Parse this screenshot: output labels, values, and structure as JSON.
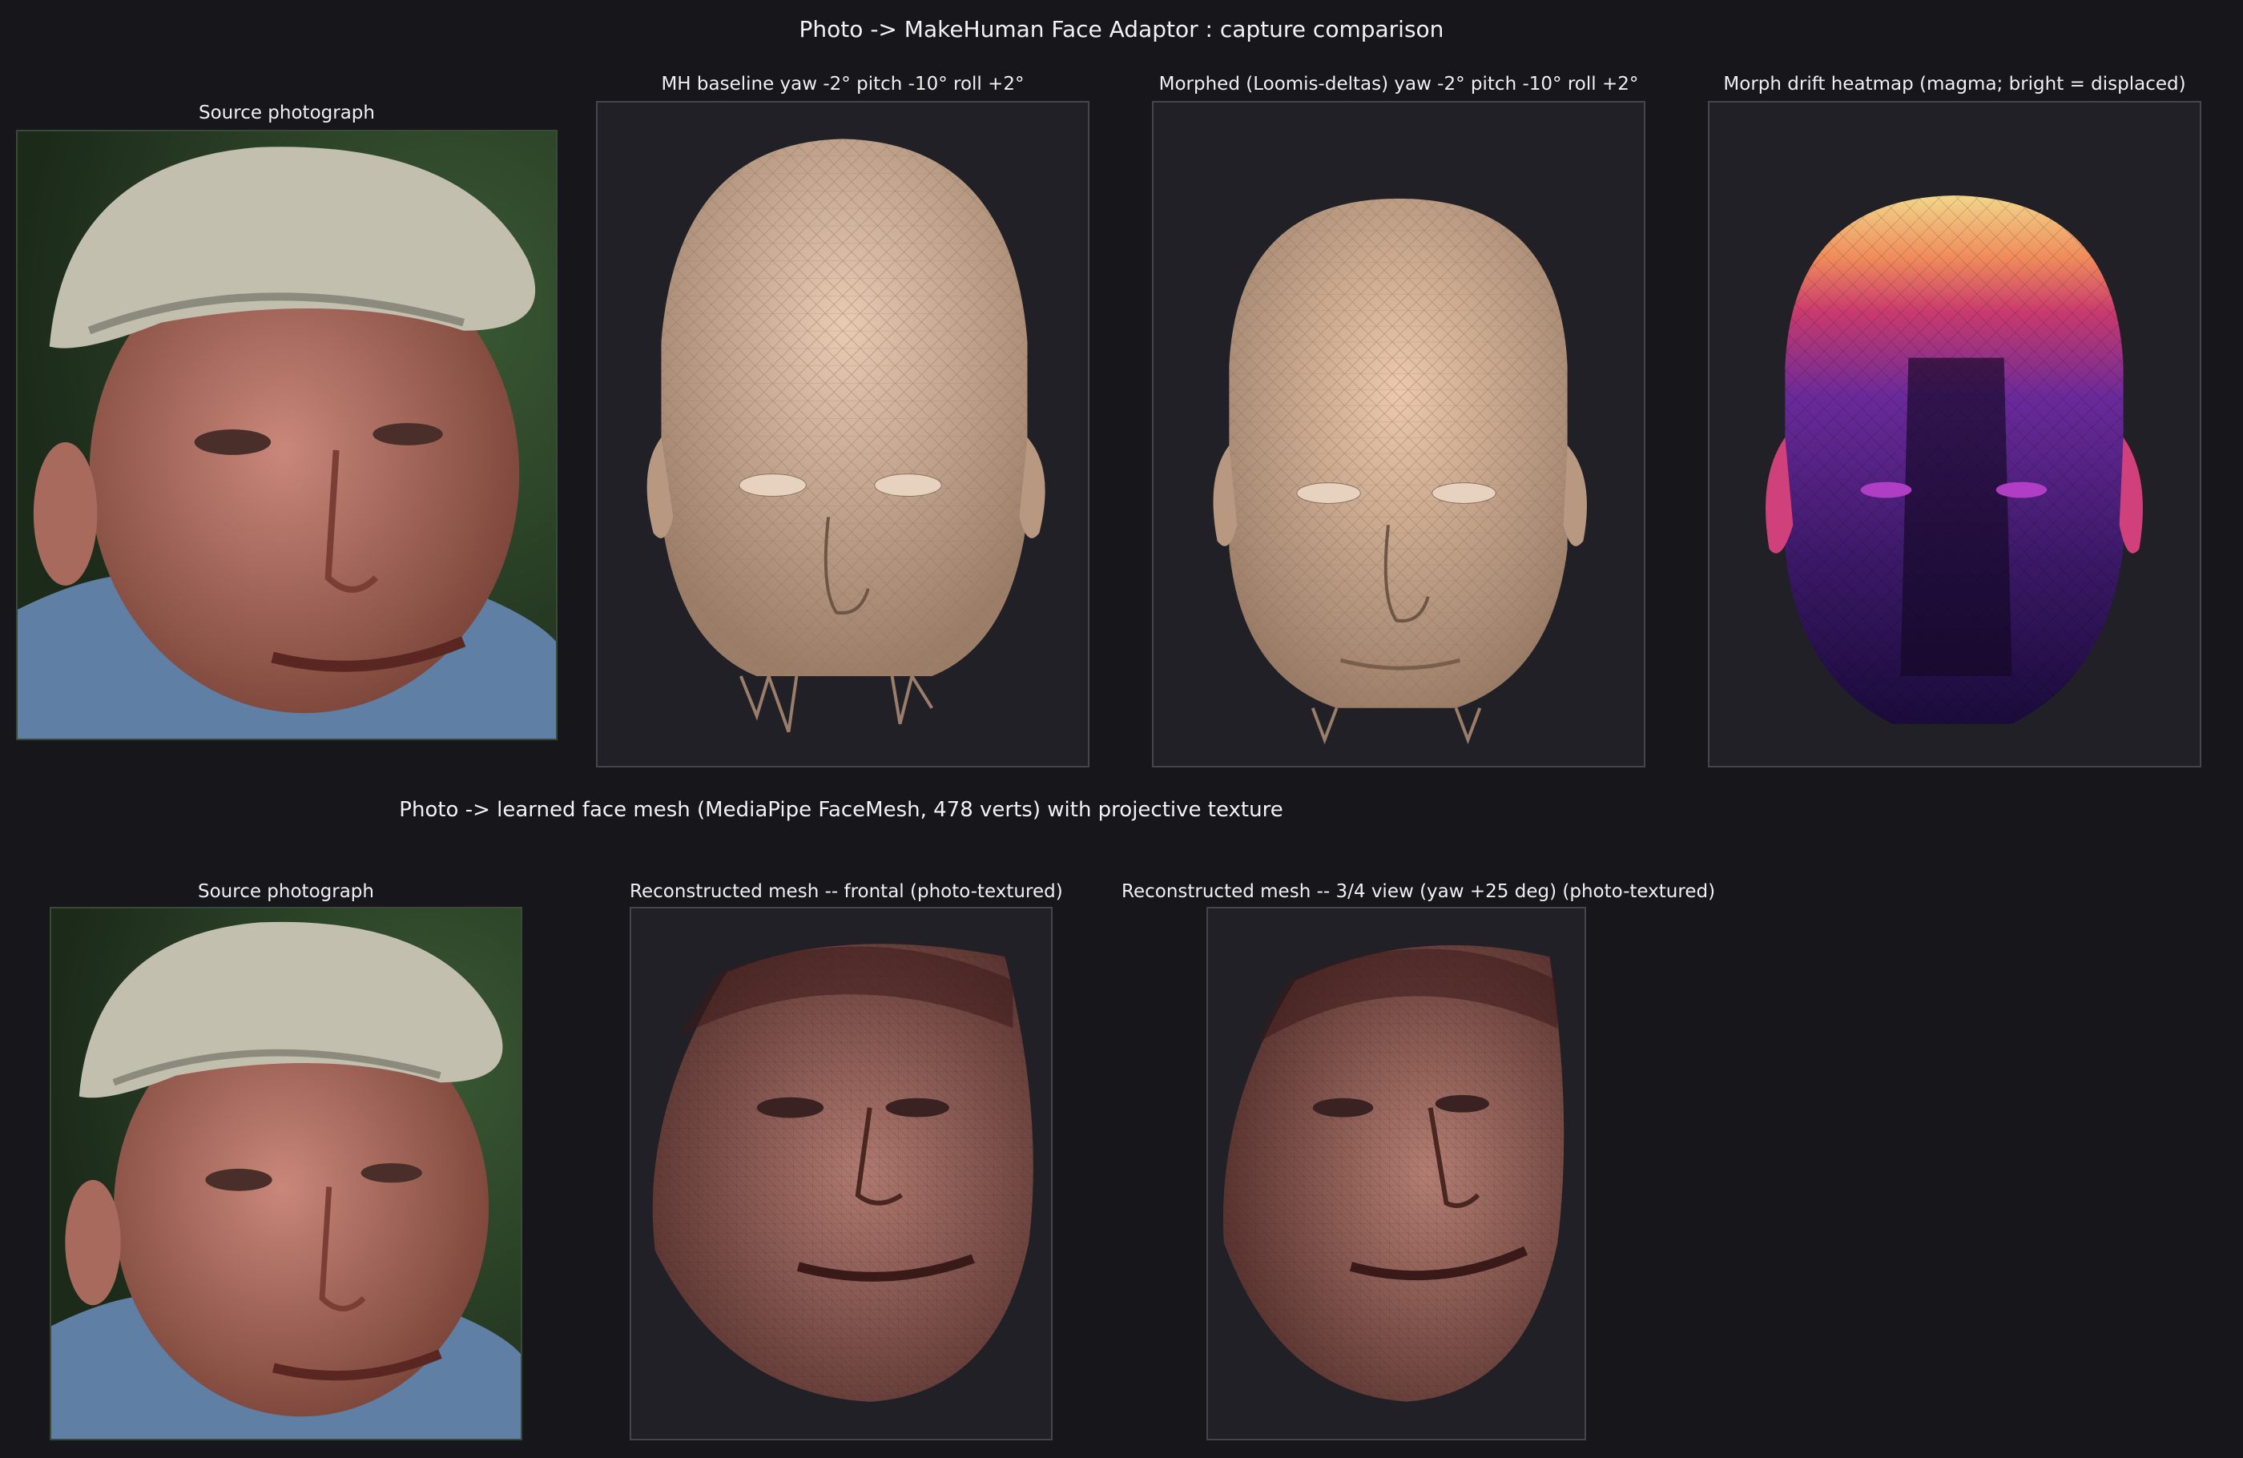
{
  "window": {
    "title": "Photo -> MakeHuman Face Adaptor : capture comparison"
  },
  "row1": {
    "panels": [
      {
        "title": "Source photograph"
      },
      {
        "title": "MH baseline  yaw -2°  pitch -10°  roll +2°"
      },
      {
        "title": "Morphed (Loomis-deltas)  yaw -2°  pitch -10°  roll +2°"
      },
      {
        "title": "Morph drift heatmap  (magma; bright = displaced)"
      }
    ]
  },
  "row2": {
    "title": "Photo -> learned face mesh (MediaPipe FaceMesh, 478 verts) with projective texture",
    "panels": [
      {
        "title": "Source photograph"
      },
      {
        "title": "Reconstructed mesh -- frontal (photo-textured)"
      },
      {
        "title": "Reconstructed mesh -- 3/4 view (yaw +25 deg) (photo-textured)"
      }
    ]
  },
  "colors": {
    "background": "#16161b",
    "panel_bg": "#202026",
    "skin_mesh": "#d4b49a",
    "heatmap_hot": "#f7e07a",
    "heatmap_mid": "#c93a6e",
    "heatmap_cold": "#1a0b3a"
  },
  "icons": [
    "photo-image",
    "head-mesh-render",
    "heatmap-render",
    "textured-mesh-render"
  ]
}
